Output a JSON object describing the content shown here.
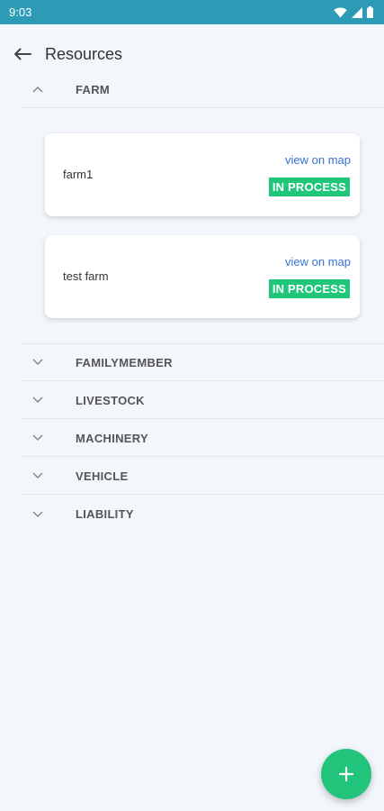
{
  "status_bar": {
    "time": "9:03"
  },
  "header": {
    "title": "Resources"
  },
  "sections": {
    "farm": {
      "label": "FARM",
      "expanded": true,
      "items": [
        {
          "name": "farm1",
          "link": "view on map",
          "status": "IN PROCESS"
        },
        {
          "name": "test farm",
          "link": "view on map",
          "status": "IN PROCESS"
        }
      ]
    },
    "familymember": {
      "label": "FAMILYMEMBER"
    },
    "livestock": {
      "label": "LIVESTOCK"
    },
    "machinery": {
      "label": "MACHINERY"
    },
    "vehicle": {
      "label": "VEHICLE"
    },
    "liability": {
      "label": "LIABILITY"
    }
  },
  "fab": {
    "icon": "plus-icon"
  },
  "colors": {
    "status_bar": "#2e9bb6",
    "badge": "#20c77a",
    "link": "#3a6fd8",
    "fab": "#22c47c",
    "background": "#f3f7fc"
  }
}
